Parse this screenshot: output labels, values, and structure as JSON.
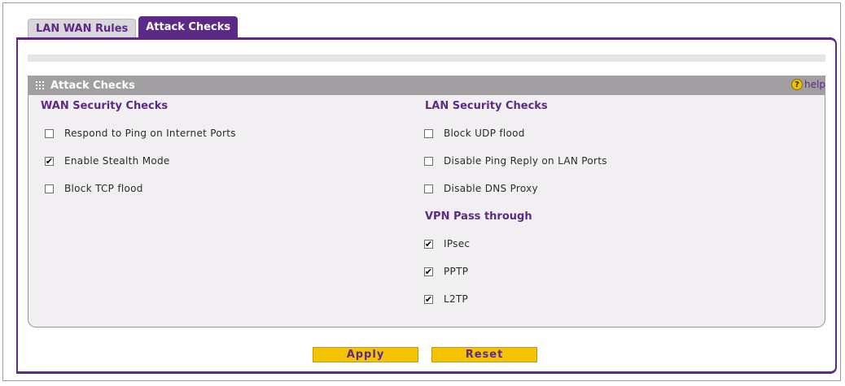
{
  "tabs": [
    {
      "label": "LAN WAN Rules",
      "active": false
    },
    {
      "label": "Attack Checks",
      "active": true
    }
  ],
  "section": {
    "title": "Attack Checks",
    "help_label": "help",
    "help_glyph": "?"
  },
  "wan": {
    "heading": "WAN Security Checks",
    "items": [
      {
        "label": "Respond to Ping on Internet Ports",
        "checked": false
      },
      {
        "label": "Enable Stealth Mode",
        "checked": true
      },
      {
        "label": "Block TCP flood",
        "checked": false
      }
    ]
  },
  "lan": {
    "heading": "LAN Security Checks",
    "items": [
      {
        "label": "Block UDP flood",
        "checked": false
      },
      {
        "label": "Disable Ping Reply on LAN Ports",
        "checked": false
      },
      {
        "label": "Disable DNS Proxy",
        "checked": false
      }
    ]
  },
  "vpn": {
    "heading": "VPN Pass through",
    "items": [
      {
        "label": "IPsec",
        "checked": true
      },
      {
        "label": "PPTP",
        "checked": true
      },
      {
        "label": "L2TP",
        "checked": true
      }
    ]
  },
  "buttons": {
    "apply": "Apply",
    "reset": "Reset"
  },
  "colors": {
    "accent": "#5c2a86",
    "header_bar": "#a19fa1",
    "button": "#f5c400"
  }
}
